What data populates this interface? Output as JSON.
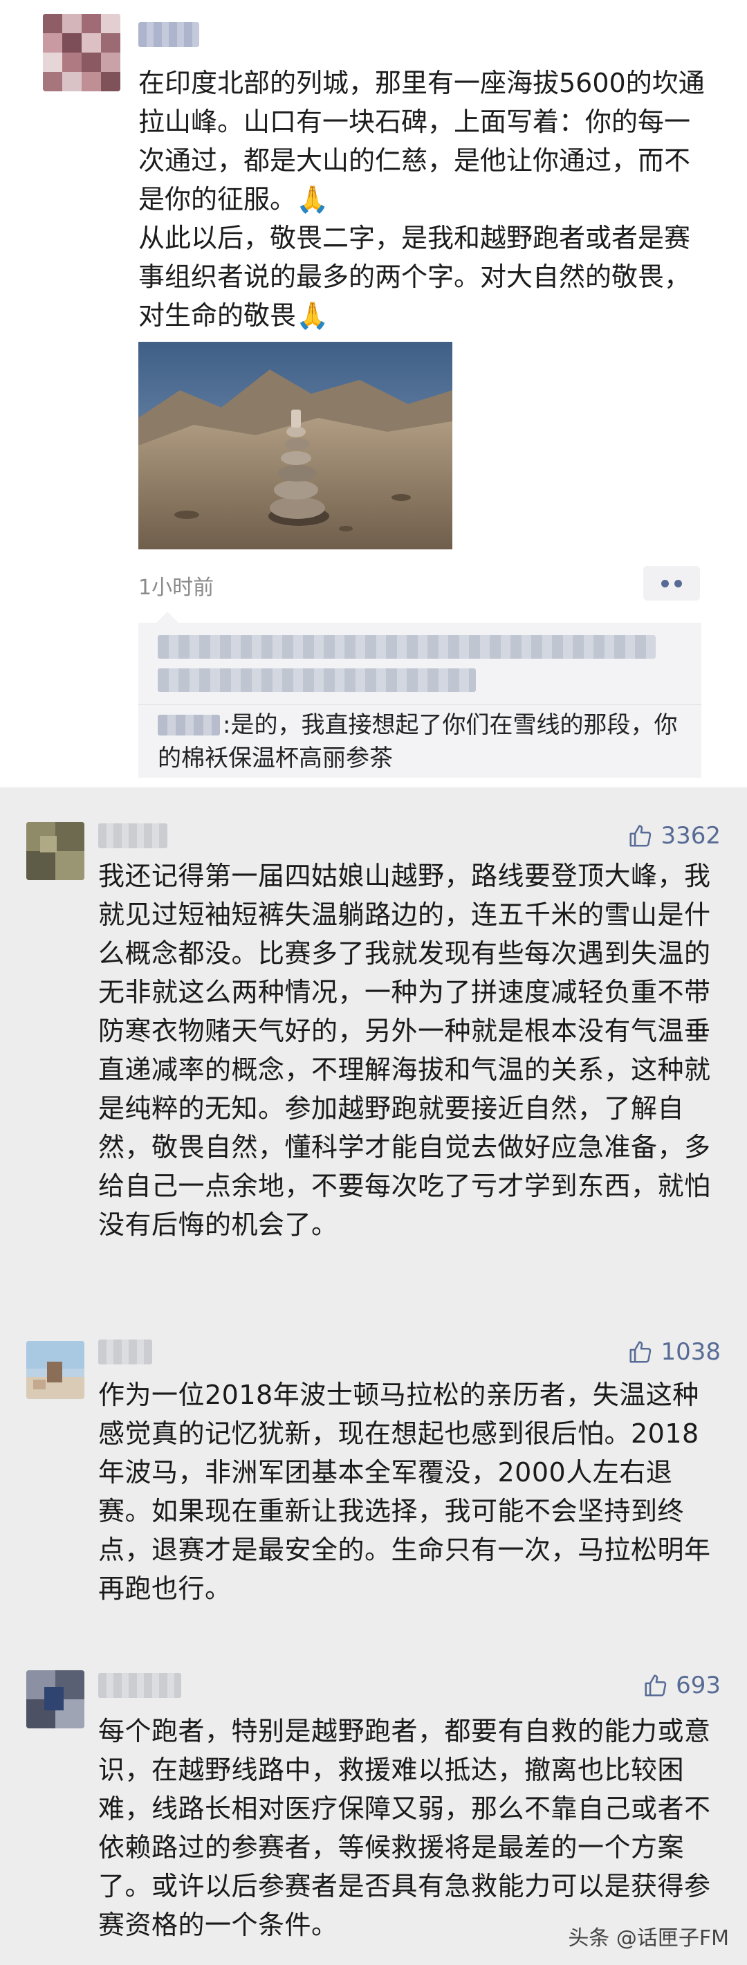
{
  "moment": {
    "text": "在印度北部的列城，那里有一座海拔5600的坎通拉山峰。山口有一块石碑，上面写着：你的每一次通过，都是大山的仁慈，是他让你通过，而不是你的征服。🙏\n从此以后，敬畏二字，是我和越野跑者或者是赛事组织者说的最多的两个字。对大自然的敬畏，对生命的敬畏🙏",
    "time": "1小时前",
    "reply": {
      "text": "是的，我直接想起了你们在雪线的那段，你的棉袄保温杯高丽参茶"
    }
  },
  "comments": [
    {
      "likes": "3362",
      "text": "我还记得第一届四姑娘山越野，路线要登顶大峰，我就见过短袖短裤失温躺路边的，连五千米的雪山是什么概念都没。比赛多了我就发现有些每次遇到失温的无非就这么两种情况，一种为了拼速度减轻负重不带防寒衣物赌天气好的，另外一种就是根本没有气温垂直递减率的概念，不理解海拔和气温的关系，这种就是纯粹的无知。参加越野跑就要接近自然，了解自然，敬畏自然，懂科学才能自觉去做好应急准备，多给自己一点余地，不要每次吃了亏才学到东西，就怕没有后悔的机会了。"
    },
    {
      "likes": "1038",
      "text": "作为一位2018年波士顿马拉松的亲历者，失温这种感觉真的记忆犹新，现在想起也感到很后怕。2018年波马，非洲军团基本全军覆没，2000人左右退赛。如果现在重新让我选择，我可能不会坚持到终点，退赛才是最安全的。生命只有一次，马拉松明年再跑也行。"
    },
    {
      "likes": "693",
      "text": "每个跑者，特别是越野跑者，都要有自救的能力或意识，在越野线路中，救援难以抵达，撤离也比较困难，线路长相对医疗保障又弱，那么不靠自己或者不依赖路过的参赛者，等候救援将是最差的一个方案了。或许以后参赛者是否具有急救能力可以是获得参赛资格的一个条件。"
    }
  ],
  "watermark": "头条 @话匣子FM",
  "colors": {
    "link": "#576b95",
    "time": "#8a8a8a",
    "background": "#ededed"
  },
  "icons": [
    "thumbs-up-icon",
    "more-dots-icon"
  ]
}
